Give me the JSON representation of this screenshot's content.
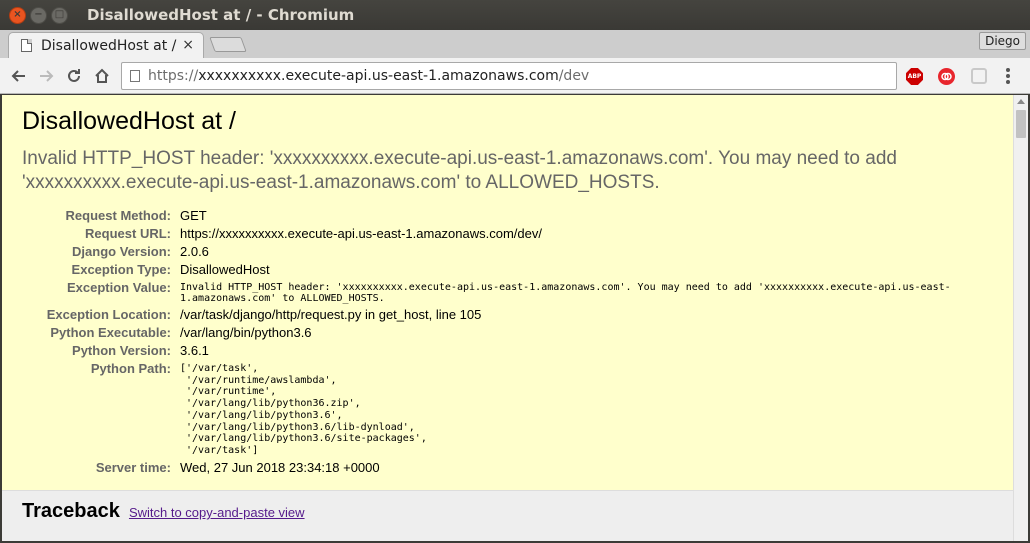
{
  "window": {
    "title": "DisallowedHost at / - Chromium"
  },
  "tab": {
    "title": "DisallowedHost at /",
    "close_glyph": "×"
  },
  "profile": {
    "name": "Diego"
  },
  "omnibox": {
    "scheme": "https://",
    "host": "xxxxxxxxxx.execute-api.us-east-1.amazonaws.com",
    "path": "/dev"
  },
  "extensions": {
    "abp_label": "ABP"
  },
  "icons": {
    "back": "back-arrow-icon",
    "forward": "forward-arrow-icon",
    "reload": "reload-icon",
    "home": "home-icon",
    "page": "page-icon",
    "menu": "kebab-menu-icon"
  },
  "page": {
    "title": "DisallowedHost at /",
    "subtitle": "Invalid HTTP_HOST header: 'xxxxxxxxxx.execute-api.us-east-1.amazonaws.com'. You may need to add 'xxxxxxxxxx.execute-api.us-east-1.amazonaws.com' to ALLOWED_HOSTS.",
    "meta": [
      {
        "label": "Request Method:",
        "value": "GET",
        "style": "normal"
      },
      {
        "label": "Request URL:",
        "value": "https://xxxxxxxxxx.execute-api.us-east-1.amazonaws.com/dev/",
        "style": "normal"
      },
      {
        "label": "Django Version:",
        "value": "2.0.6",
        "style": "normal"
      },
      {
        "label": "Exception Type:",
        "value": "DisallowedHost",
        "style": "normal"
      },
      {
        "label": "Exception Value:",
        "value": "Invalid HTTP_HOST header: 'xxxxxxxxxx.execute-api.us-east-1.amazonaws.com'. You may need to add 'xxxxxxxxxx.execute-api.us-east-1.amazonaws.com' to ALLOWED_HOSTS.",
        "style": "mono"
      },
      {
        "label": "Exception Location:",
        "value": "/var/task/django/http/request.py in get_host, line 105",
        "style": "normal"
      },
      {
        "label": "Python Executable:",
        "value": "/var/lang/bin/python3.6",
        "style": "normal"
      },
      {
        "label": "Python Version:",
        "value": "3.6.1",
        "style": "normal"
      },
      {
        "label": "Python Path:",
        "value": "['/var/task',\n '/var/runtime/awslambda',\n '/var/runtime',\n '/var/lang/lib/python36.zip',\n '/var/lang/lib/python3.6',\n '/var/lang/lib/python3.6/lib-dynload',\n '/var/lang/lib/python3.6/site-packages',\n '/var/task']",
        "style": "pre"
      },
      {
        "label": "Server time:",
        "value": "Wed, 27 Jun 2018 23:34:18 +0000",
        "style": "normal"
      }
    ],
    "traceback": {
      "title": "Traceback",
      "link": "Switch to copy-and-paste view"
    }
  },
  "colors": {
    "summary_bg": "#ffffcc",
    "traceback_bg": "#eeeeee",
    "link": "#551a8b",
    "close_button": "#e95420"
  }
}
